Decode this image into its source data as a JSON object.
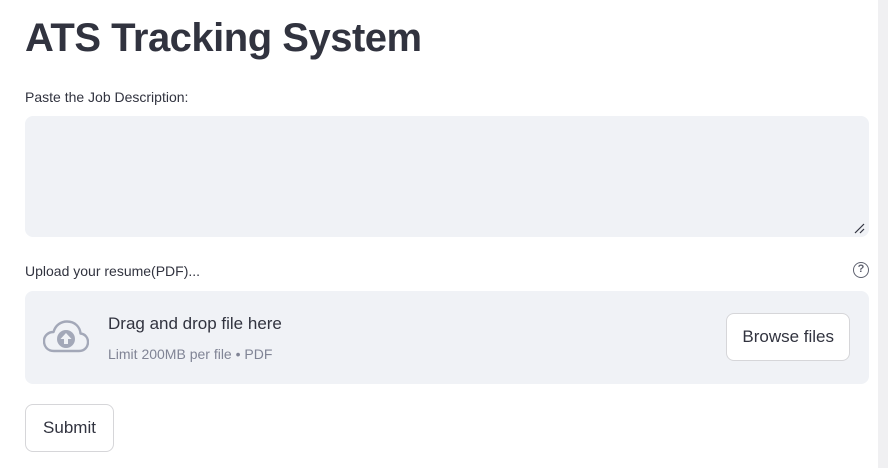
{
  "page": {
    "title": "ATS Tracking System"
  },
  "job_description": {
    "label": "Paste the Job Description:",
    "value": ""
  },
  "resume_upload": {
    "label": "Upload your resume(PDF)...",
    "help_icon": "help-circle-icon",
    "help_glyph": "?",
    "dropzone_title": "Drag and drop file here",
    "dropzone_subtitle": "Limit 200MB per file • PDF",
    "upload_icon": "cloud-upload-icon",
    "browse_label": "Browse files"
  },
  "actions": {
    "submit_label": "Submit"
  },
  "colors": {
    "text": "#31333f",
    "input_background": "#f0f2f6",
    "muted_text": "#808495",
    "icon": "#a3a8b8"
  }
}
